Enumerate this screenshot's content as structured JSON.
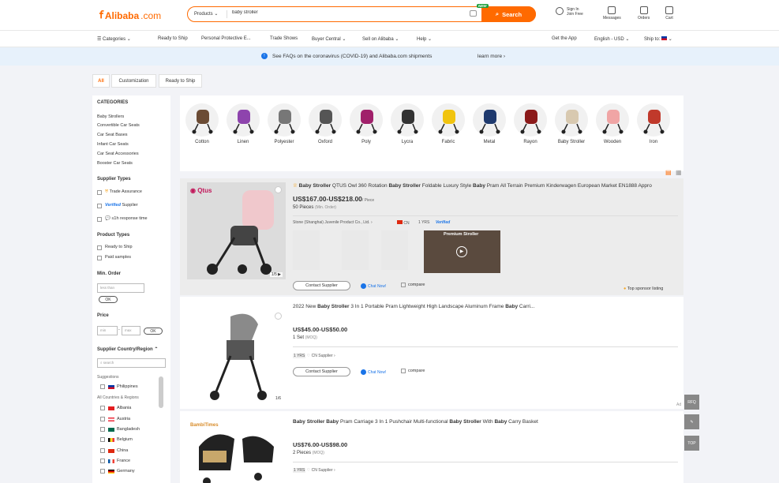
{
  "header": {
    "logo_text": "Alibaba",
    "logo_suffix": ".com",
    "search_type": "Products",
    "search_value": "baby stroller",
    "search_button": "Search",
    "new_badge": "NEW",
    "sign_in": "Sign In",
    "join_free": "Join Free",
    "messages": "Messages",
    "orders": "Orders",
    "cart": "Cart"
  },
  "nav": {
    "categories": "Categories",
    "items": [
      "Ready to Ship",
      "Personal Protective E...",
      "Trade Shows",
      "Buyer Central",
      "Sell on Alibaba",
      "Help"
    ],
    "get_app": "Get the App",
    "language": "English - USD",
    "ship_to": "Ship to:"
  },
  "banner": {
    "text": "See FAQs on the coronavirus (COVID-19) and Alibaba.com shipments",
    "link": "learn more"
  },
  "filter_tabs": [
    "All",
    "Customization",
    "Ready to Ship"
  ],
  "sidebar": {
    "categories_title": "CATEGORIES",
    "categories": [
      "Baby Strollers",
      "Convertible Car Seats",
      "Car Seat Bases",
      "Infant Car Seats",
      "Car Seat Accessories",
      "Booster Car Seats"
    ],
    "supplier_types_title": "Supplier Types",
    "trade_assurance": "Trade Assurance",
    "verified": "Verified",
    "supplier": "Supplier",
    "response_time": "≤1h response time",
    "product_types_title": "Product Types",
    "product_types": [
      "Ready to Ship",
      "Paid samples"
    ],
    "min_order_title": "Min. Order",
    "min_order_placeholder": "less than",
    "ok": "OK",
    "price_title": "Price",
    "price_min": "min",
    "price_max": "max",
    "region_title": "Supplier Country/Region",
    "region_search": "search",
    "suggestions": "Suggestions",
    "suggested_country": "Philippines",
    "all_countries": "All Countries & Regions",
    "countries": [
      "Albania",
      "Austria",
      "Bangladesh",
      "Belgium",
      "China",
      "France",
      "Germany"
    ]
  },
  "category_strip": [
    "Cotton",
    "Linen",
    "Polyester",
    "Oxford",
    "Poly",
    "Lycra",
    "Fabric",
    "Metal",
    "Rayon",
    "Iron",
    "Baby Stroller",
    "Wooden",
    "Iron"
  ],
  "listings": [
    {
      "title_parts": [
        [
          "Baby Stroller",
          true
        ],
        [
          " QTUS Owl 360 Rotation ",
          false
        ],
        [
          "Baby Stroller",
          true
        ],
        [
          " Foldable Luxury Style ",
          false
        ],
        [
          "Baby",
          true
        ],
        [
          " Pram All Terrain Premium Kinderwagen European Market EN1888 Appro",
          false
        ]
      ],
      "price": "US$167.00-US$218.00",
      "price_unit": "/ Piece",
      "moq": "50 Pieces",
      "moq_note": "(Min. Order)",
      "supplier": "Stone (Shanghai) Juvenile Product Co., Ltd.",
      "country": "CN",
      "years": "1 YRS",
      "verified": "Verified",
      "contact": "Contact Supplier",
      "chat": "Chat Now!",
      "compare": "compare",
      "img_count": "1/5",
      "brand": "Qtus",
      "premium": "Premium Stroller",
      "sponsor": "Top sponsor listing"
    },
    {
      "title_parts": [
        [
          "2022 New ",
          false
        ],
        [
          "Baby Stroller",
          true
        ],
        [
          " 3 In 1 Portable Pram Lightweight High Landscape Aluminum Frame ",
          false
        ],
        [
          "Baby",
          true
        ],
        [
          " Carri...",
          false
        ]
      ],
      "price": "US$45.00-US$50.00",
      "moq": "1 Set",
      "moq_note": "(MOQ)",
      "years": "1 YRS",
      "country": "CN",
      "supplier_label": "Supplier",
      "contact": "Contact Supplier",
      "chat": "Chat Now!",
      "compare": "compare",
      "img_count": "1/6",
      "ad": "Ad"
    },
    {
      "title_parts": [
        [
          "Baby Stroller",
          true
        ],
        [
          " ",
          false
        ],
        [
          "Baby",
          true
        ],
        [
          " Pram Carriage 3 In 1 Pushchair Multi-functional ",
          false
        ],
        [
          "Baby Stroller",
          true
        ],
        [
          " With ",
          false
        ],
        [
          "Baby",
          true
        ],
        [
          " Carry Basket",
          false
        ]
      ],
      "price": "US$76.00-US$98.00",
      "moq": "2 Pieces",
      "moq_note": "(MOQ)",
      "years": "1 YRS",
      "country": "CN",
      "supplier_label": "Supplier",
      "brand": "BambiTimes"
    }
  ],
  "floating": [
    "RFQ",
    "TOP"
  ],
  "colors": {
    "accent": "#ff6a00",
    "link": "#1a74e8",
    "banner": "#e7f1fb"
  }
}
